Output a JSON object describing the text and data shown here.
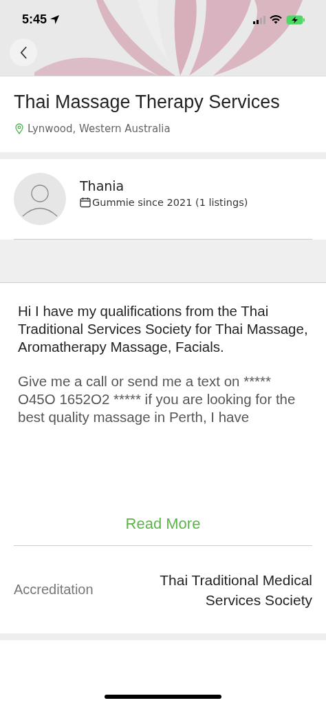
{
  "status_bar": {
    "time": "5:45"
  },
  "listing": {
    "title": "Thai Massage Therapy Services",
    "location": "Lynwood, Western Australia"
  },
  "seller": {
    "name": "Thania",
    "member_info": "Gummie since 2021 (1 listings)"
  },
  "description": {
    "paragraphs": [
      "Hi I have my qualifications from the Thai Traditional Services Society for Thai Massage, Aromatherapy Massage, Facials.",
      "Give me a call or send me a text on ***** O45O 1652O2 ***** if you are looking for the best quality massage in Perth, I have"
    ],
    "read_more": "Read More"
  },
  "details": [
    {
      "label": "Accreditation",
      "value": "Thai Traditional Medical Services Society"
    }
  ]
}
